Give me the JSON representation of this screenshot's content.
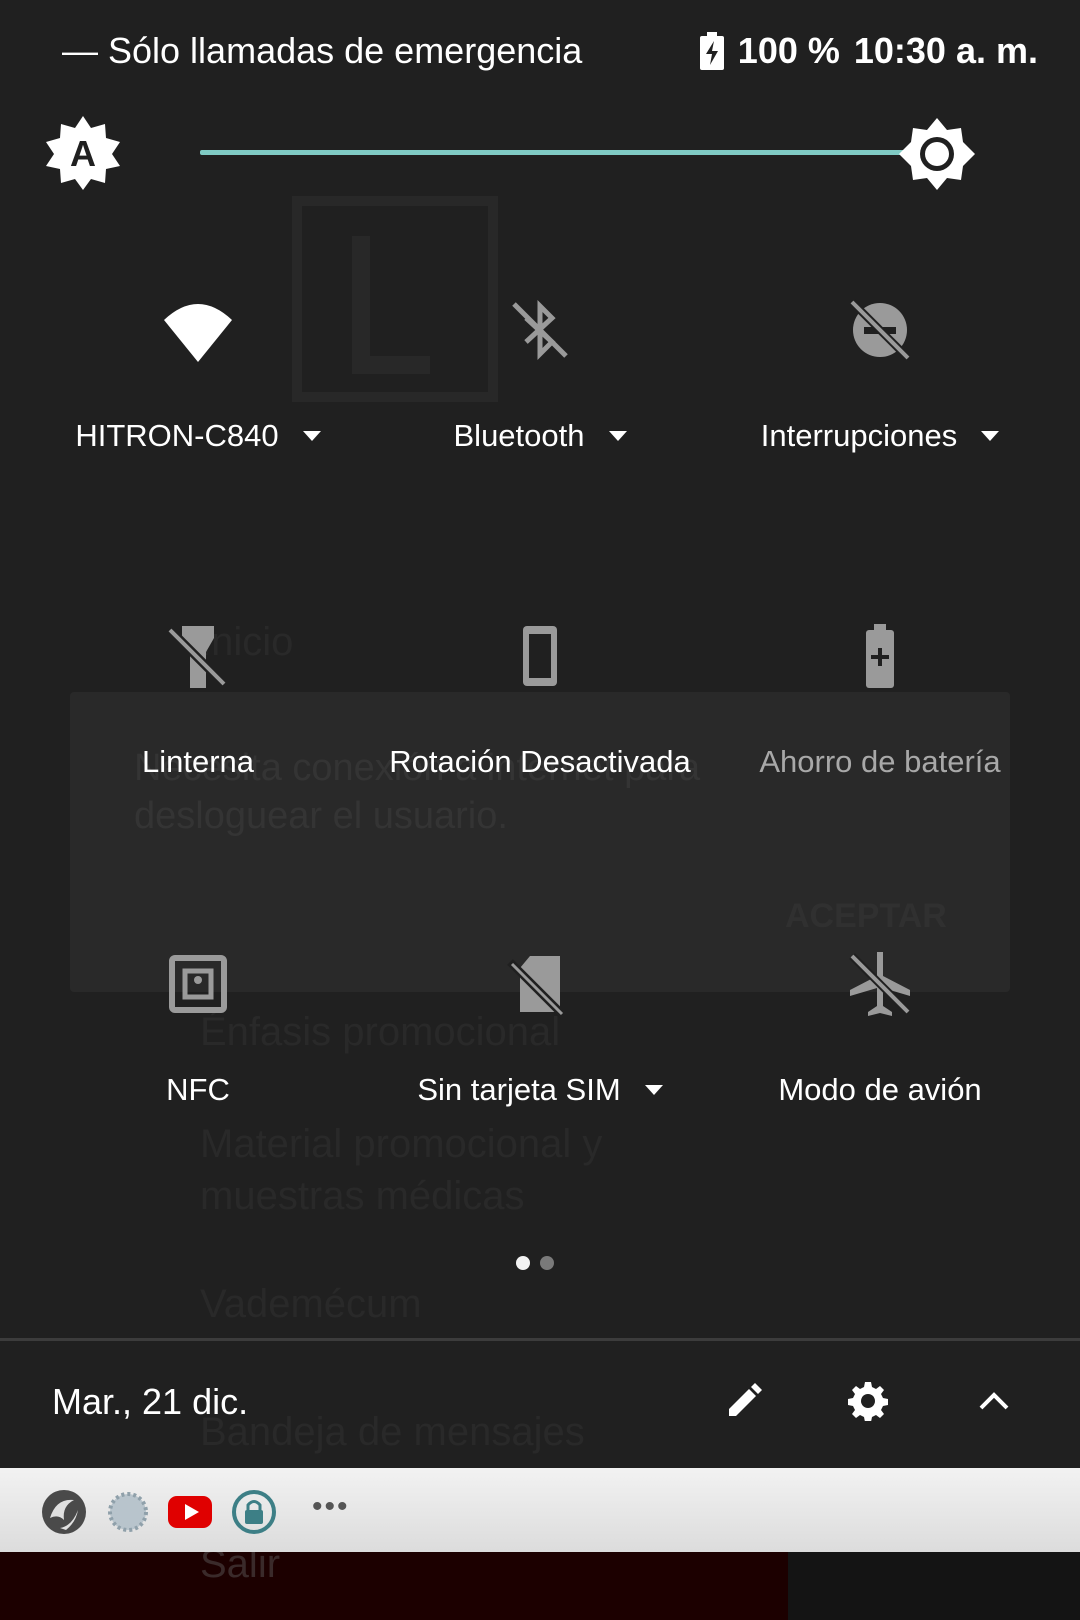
{
  "status_bar": {
    "carrier_text": "— Sólo llamadas de emergencia",
    "battery_text": "100 %",
    "time": "10:30 a. m."
  },
  "brightness": {
    "level": 0.94,
    "track_color": "#80cbc4"
  },
  "tiles": [
    {
      "label": "HITRON-C840",
      "icon": "wifi-icon",
      "dropdown": true,
      "active": true
    },
    {
      "label": "Bluetooth",
      "icon": "bluetooth-off-icon",
      "dropdown": true,
      "active": false
    },
    {
      "label": "Interrupciones",
      "icon": "do-not-disturb-off-icon",
      "dropdown": true,
      "active": false
    },
    {
      "label": "Linterna",
      "icon": "flashlight-off-icon",
      "dropdown": false,
      "active": false
    },
    {
      "label": "Rotación Desactivada",
      "icon": "rotation-lock-icon",
      "dropdown": false,
      "active": false
    },
    {
      "label": "Ahorro de batería",
      "icon": "battery-saver-icon",
      "dropdown": false,
      "active": false
    },
    {
      "label": "NFC",
      "icon": "nfc-icon",
      "dropdown": false,
      "active": false
    },
    {
      "label": "Sin tarjeta SIM",
      "icon": "no-sim-icon",
      "dropdown": true,
      "active": false
    },
    {
      "label": "Modo de avión",
      "icon": "airplane-mode-off-icon",
      "dropdown": false,
      "active": false
    }
  ],
  "pager": {
    "pages": 2,
    "current": 1
  },
  "footer": {
    "date": "Mar., 21 dic."
  },
  "notification_icons": [
    "app-logo-icon",
    "sync-icon",
    "youtube-icon",
    "lock-icon",
    "more-icon"
  ],
  "background_app": {
    "menu_home": "Inicio",
    "dialog_message": "Necesita conexión a internet para desloguear el usuario.",
    "dialog_button": "ACEPTAR",
    "menu_emphasis": "Énfasis promocional",
    "menu_material": "Material promocional y muestras médicas",
    "menu_vademecum": "Vademécum",
    "menu_inbox": "Bandeja de mensajes",
    "menu_exit": "Salir"
  }
}
